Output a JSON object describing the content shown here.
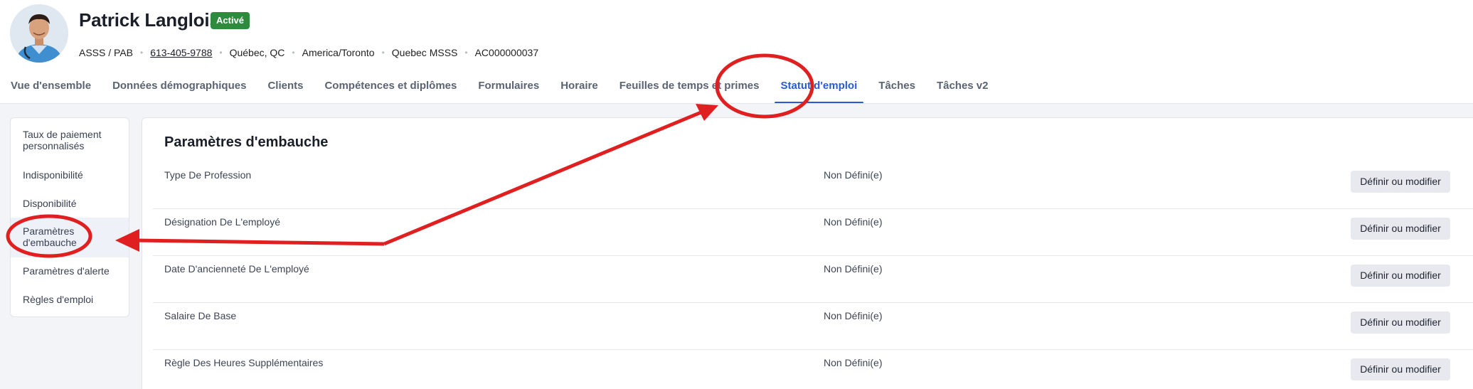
{
  "profile": {
    "name": "Patrick Langlois",
    "status": "Activé",
    "meta": {
      "role": "ASSS / PAB",
      "phone": "613-405-9788",
      "location": "Québec, QC",
      "timezone": "America/Toronto",
      "organization": "Quebec MSSS",
      "employee_id": "AC000000037"
    }
  },
  "tabs": [
    {
      "label": "Vue d'ensemble"
    },
    {
      "label": "Données démographiques"
    },
    {
      "label": "Clients"
    },
    {
      "label": "Compétences et diplômes"
    },
    {
      "label": "Formulaires"
    },
    {
      "label": "Horaire"
    },
    {
      "label": "Feuilles de temps et primes"
    },
    {
      "label": "Statut d'emploi"
    },
    {
      "label": "Tâches"
    },
    {
      "label": "Tâches v2"
    }
  ],
  "active_tab": "Statut d'emploi",
  "sidebar": {
    "items": [
      {
        "line1": "Taux de paiement",
        "line2": "personnalisés"
      },
      {
        "line1": "Indisponibilité",
        "line2": ""
      },
      {
        "line1": "Disponibilité",
        "line2": ""
      },
      {
        "line1": "Paramètres",
        "line2": "d'embauche"
      },
      {
        "line1": "Paramètres d'alerte",
        "line2": ""
      },
      {
        "line1": "Règles d'emploi",
        "line2": ""
      }
    ],
    "active_item": "Paramètres d'embauche"
  },
  "main": {
    "title": "Paramètres d'embauche",
    "rows": [
      {
        "label": "Type De Profession",
        "value": "Non Défini(e)",
        "action": "Définir ou modifier"
      },
      {
        "label": "Désignation De L'employé",
        "value": "Non Défini(e)",
        "action": "Définir ou modifier"
      },
      {
        "label": "Date D'ancienneté De L'employé",
        "value": "Non Défini(e)",
        "action": "Définir ou modifier"
      },
      {
        "label": "Salaire De Base",
        "value": "Non Défini(e)",
        "action": "Définir ou modifier"
      },
      {
        "label": "Règle Des Heures Supplémentaires",
        "value": "Non Défini(e)",
        "action": "Définir ou modifier"
      }
    ]
  },
  "colors": {
    "accent": "#2a5bd7",
    "status_green": "#2e8b3e",
    "annotation_red": "#e02020"
  },
  "icons": {
    "avatar": "person-avatar-icon"
  }
}
